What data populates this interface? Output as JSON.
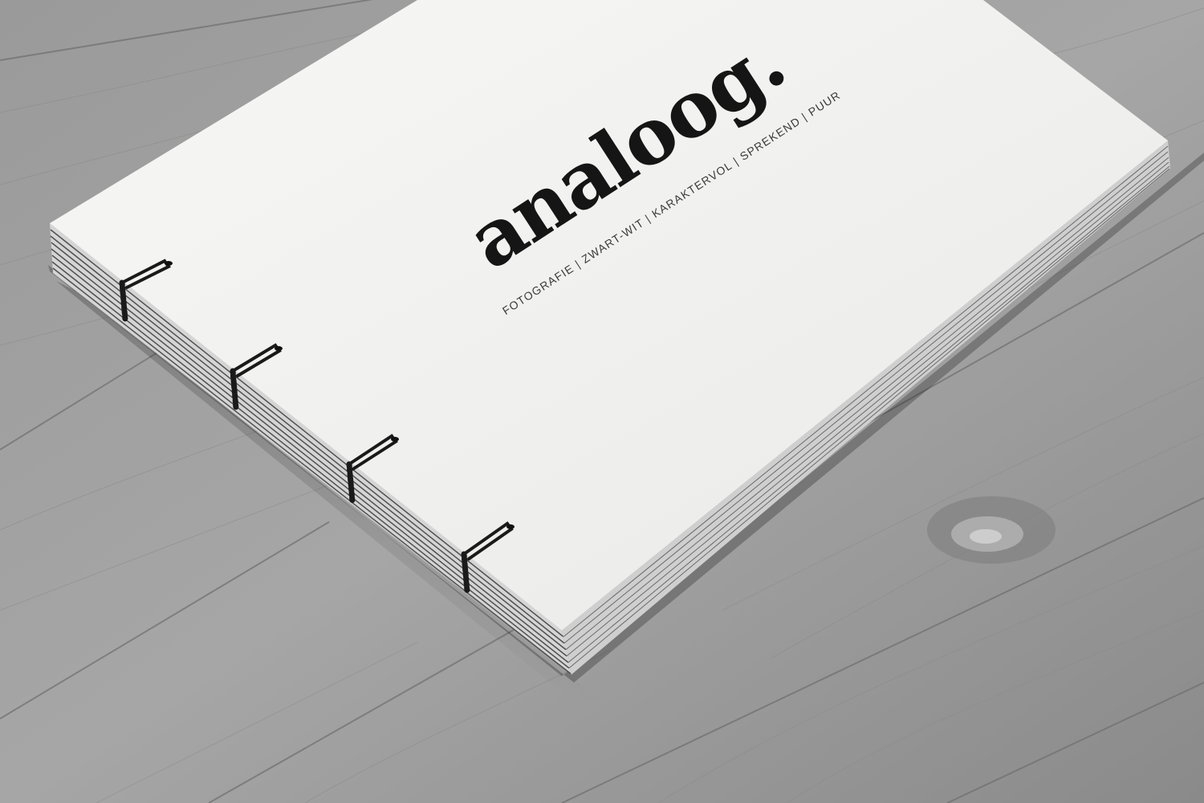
{
  "book": {
    "title": "analoog.",
    "tagline": "FOTOGRAFIE | ZWART-WIT | KARAKTERVOL | SPREKEND | PUUR"
  },
  "colors": {
    "floor_light": "#a9a9a9",
    "floor_dark": "#7c7c7c",
    "cover": "#f4f4f2",
    "ink": "#151515",
    "thread": "#1a1a1a"
  }
}
